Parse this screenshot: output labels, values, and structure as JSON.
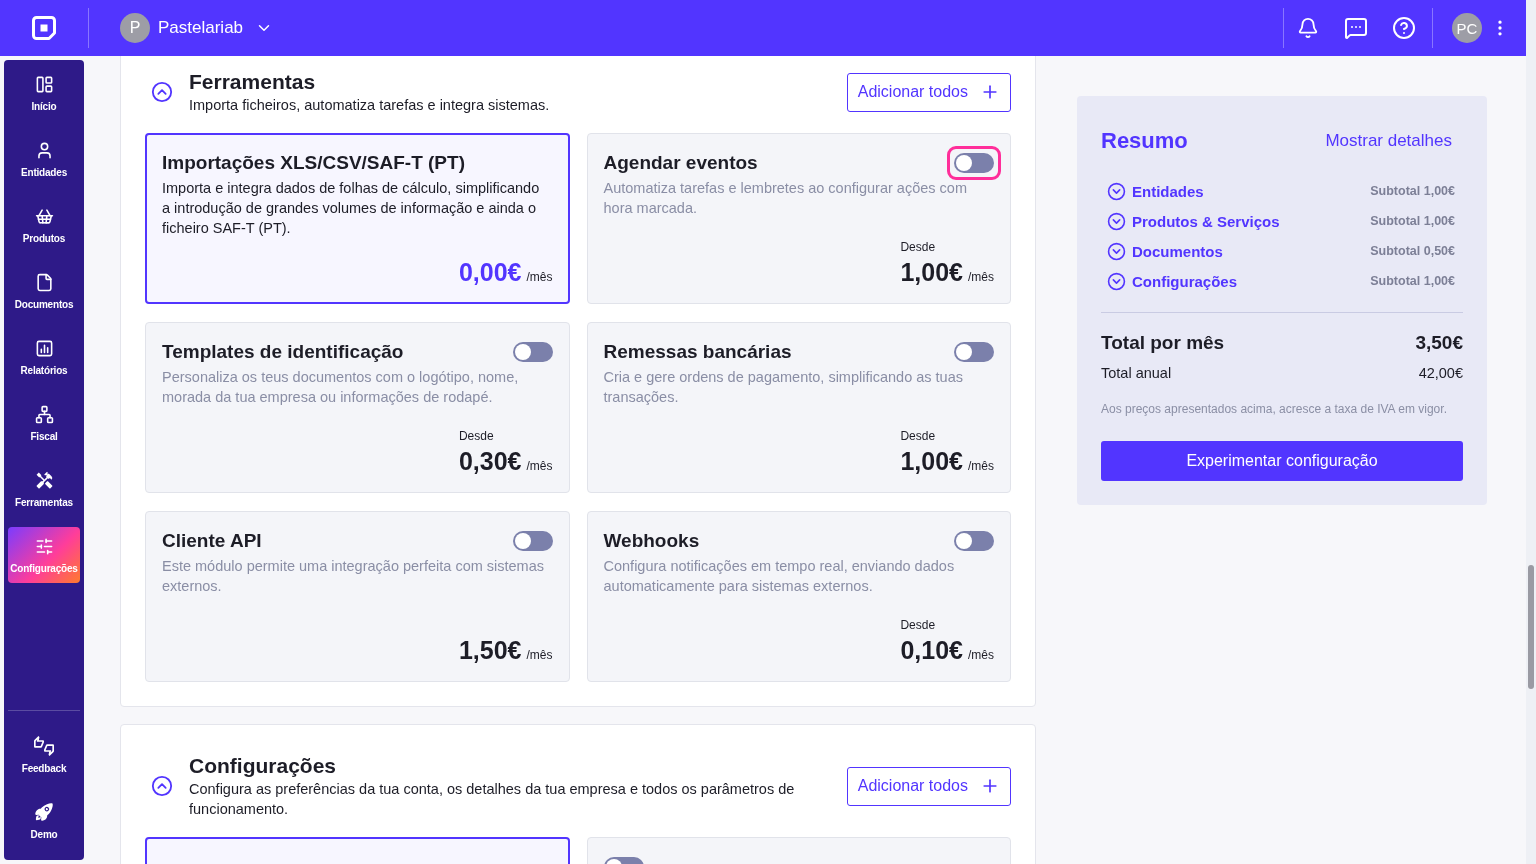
{
  "topbar": {
    "company_initial": "P",
    "company_name": "Pastelariab",
    "user_initials": "PC"
  },
  "sidebar": {
    "items": [
      {
        "label": "Início",
        "selected": false
      },
      {
        "label": "Entidades",
        "selected": false
      },
      {
        "label": "Produtos",
        "selected": false
      },
      {
        "label": "Documentos",
        "selected": false
      },
      {
        "label": "Relatórios",
        "selected": false
      },
      {
        "label": "Fiscal",
        "selected": false
      },
      {
        "label": "Ferramentas",
        "selected": false
      },
      {
        "label": "Configurações",
        "selected": true
      }
    ],
    "footer_items": [
      {
        "label": "Feedback"
      },
      {
        "label": "Demo"
      }
    ]
  },
  "sections": [
    {
      "title": "Ferramentas",
      "description": "Importa ficheiros, automatiza tarefas e integra sistemas.",
      "expanded": true,
      "add_all_button": "Adicionar todos",
      "cards": [
        {
          "title": "Importações XLS/CSV/SAF-T (PT)",
          "description": "Importa e integra dados de folhas de cálculo, simplificando a introdução de grandes volumes de informação e ainda o ficheiro SAF-T (PT).",
          "selected": true,
          "price": "0,00€",
          "period": "/mês"
        },
        {
          "title": "Agendar eventos",
          "description": "Automatiza tarefas e lembretes ao configurar ações com hora marcada.",
          "selected": false,
          "toggle": {
            "on": false,
            "focused": true
          },
          "from_label": "Desde",
          "price": "1,00€",
          "period": "/mês"
        },
        {
          "title": "Templates de identificação",
          "description": "Personaliza os teus documentos com o logótipo, nome, morada da tua empresa ou informações de rodapé.",
          "selected": false,
          "toggle": {
            "on": false,
            "focused": false
          },
          "from_label": "Desde",
          "price": "0,30€",
          "period": "/mês"
        },
        {
          "title": "Remessas bancárias",
          "description": "Cria e gere ordens de pagamento, simplificando as tuas transações.",
          "selected": false,
          "toggle": {
            "on": false,
            "focused": false
          },
          "from_label": "Desde",
          "price": "1,00€",
          "period": "/mês"
        },
        {
          "title": "Cliente API",
          "description": "Este módulo permite uma integração perfeita com sistemas externos.",
          "selected": false,
          "toggle": {
            "on": false,
            "focused": false
          },
          "price": "1,50€",
          "period": "/mês"
        },
        {
          "title": "Webhooks",
          "description": "Configura notificações em tempo real, enviando dados automaticamente para sistemas externos.",
          "selected": false,
          "toggle": {
            "on": false,
            "focused": false
          },
          "from_label": "Desde",
          "price": "0,10€",
          "period": "/mês"
        }
      ]
    },
    {
      "title": "Configurações",
      "description": "Configura as preferências da tua conta, os detalhes da tua empresa e todos os parâmetros de funcionamento.",
      "expanded": true,
      "add_all_button": "Adicionar todos",
      "cards": [
        {
          "selected": true
        },
        {
          "selected": false,
          "toggle": {
            "on": false,
            "focused": false
          }
        }
      ]
    }
  ],
  "summary": {
    "title": "Resumo",
    "details_link": "Mostrar detalhes",
    "items": [
      {
        "label": "Entidades",
        "subtotal": "Subtotal 1,00€",
        "expanded": false
      },
      {
        "label": "Produtos & Serviços",
        "subtotal": "Subtotal 1,00€",
        "expanded": false
      },
      {
        "label": "Documentos",
        "subtotal": "Subtotal 0,50€",
        "expanded": false
      },
      {
        "label": "Configurações",
        "subtotal": "Subtotal 1,00€",
        "expanded": false
      }
    ],
    "total_month_label": "Total por mês",
    "total_month": "3,50€",
    "total_year_label": "Total anual",
    "total_year": "42,00€",
    "note": "Aos preços apresentados acima, acresce a taxa de IVA em vigor.",
    "cta_button": "Experimentar configuração"
  }
}
